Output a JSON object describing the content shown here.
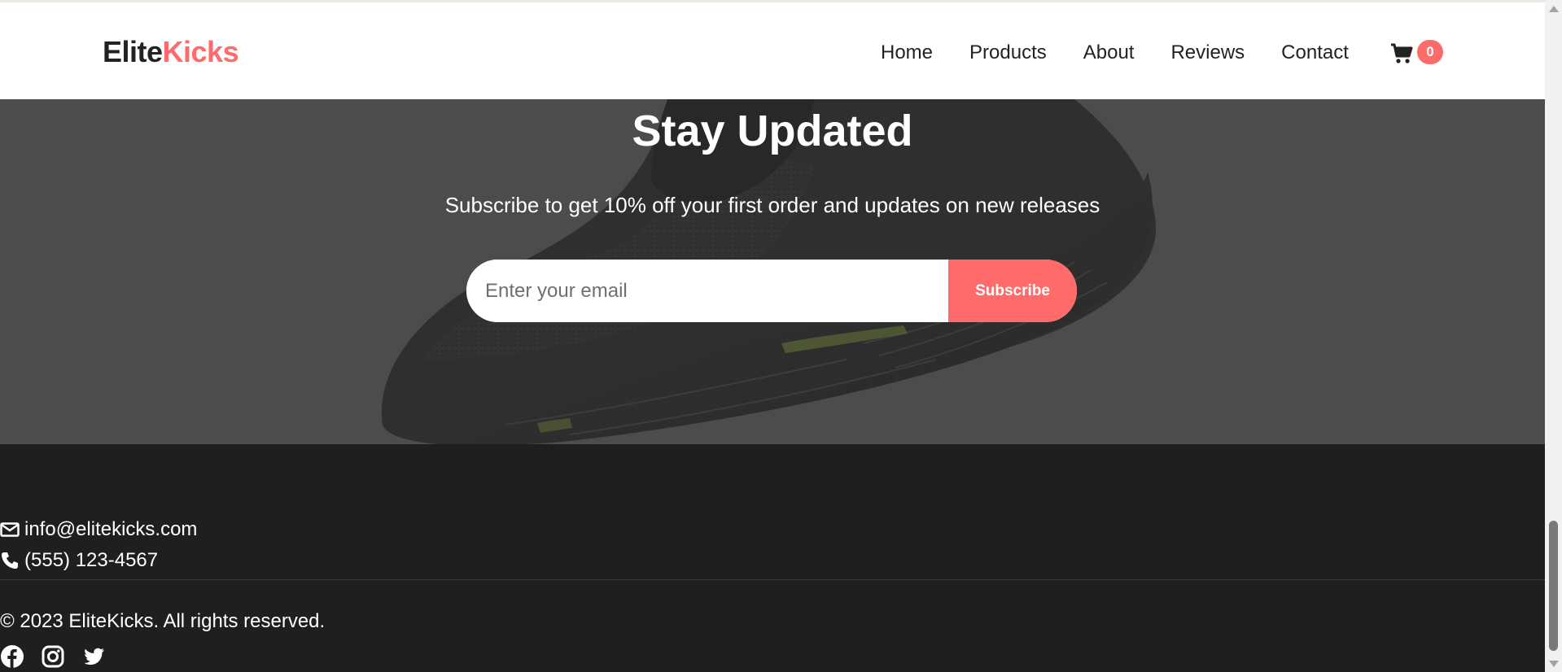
{
  "brand": {
    "part1": "Elite",
    "part2": "Kicks"
  },
  "nav": {
    "links": [
      "Home",
      "Products",
      "About",
      "Reviews",
      "Contact"
    ],
    "cart_count": "0"
  },
  "newsletter": {
    "title": "Stay Updated",
    "subtitle": "Subscribe to get 10% off your first order and updates on new releases",
    "email_placeholder": "Enter your email",
    "button_label": "Subscribe"
  },
  "footer": {
    "email": "info@elitekicks.com",
    "phone": "(555) 123-4567",
    "copyright": "© 2023 EliteKicks. All rights reserved.",
    "socials": [
      "facebook-icon",
      "instagram-icon",
      "twitter-icon"
    ]
  },
  "colors": {
    "accent": "#ff6b6b",
    "nav_bg": "#ffffff",
    "hero_bg": "#4c4c4c",
    "footer_bg": "#1f1f1f"
  }
}
